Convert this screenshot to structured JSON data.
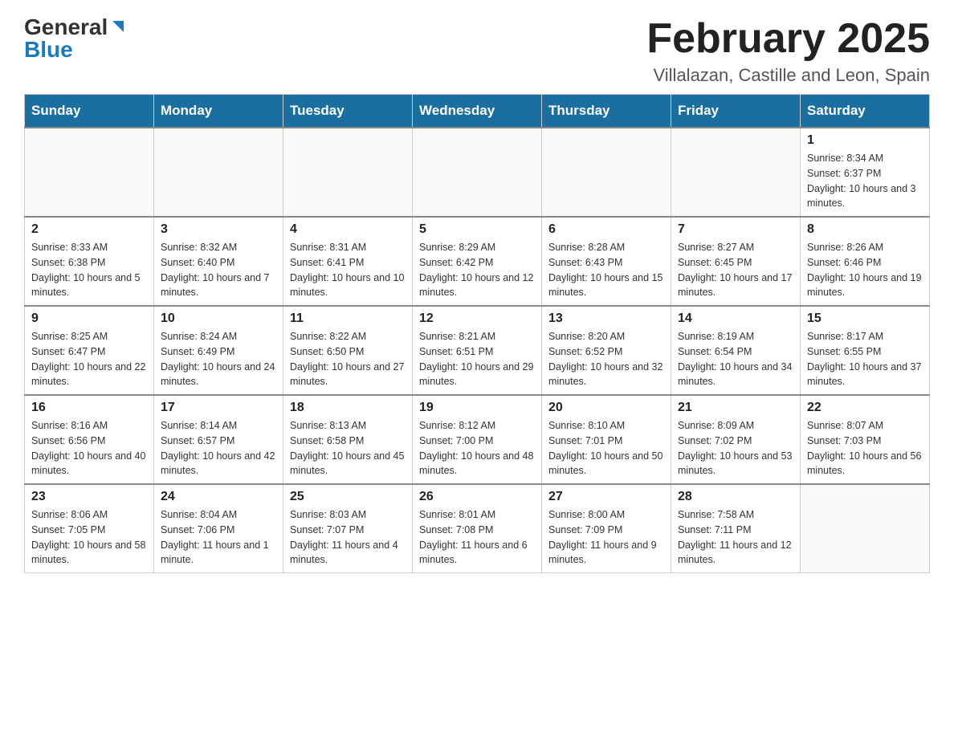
{
  "logo": {
    "general": "General",
    "blue": "Blue",
    "aria": "GeneralBlue logo"
  },
  "title": {
    "month_year": "February 2025",
    "location": "Villalazan, Castille and Leon, Spain"
  },
  "weekdays": [
    "Sunday",
    "Monday",
    "Tuesday",
    "Wednesday",
    "Thursday",
    "Friday",
    "Saturday"
  ],
  "weeks": [
    [
      {
        "day": "",
        "info": ""
      },
      {
        "day": "",
        "info": ""
      },
      {
        "day": "",
        "info": ""
      },
      {
        "day": "",
        "info": ""
      },
      {
        "day": "",
        "info": ""
      },
      {
        "day": "",
        "info": ""
      },
      {
        "day": "1",
        "info": "Sunrise: 8:34 AM\nSunset: 6:37 PM\nDaylight: 10 hours and 3 minutes."
      }
    ],
    [
      {
        "day": "2",
        "info": "Sunrise: 8:33 AM\nSunset: 6:38 PM\nDaylight: 10 hours and 5 minutes."
      },
      {
        "day": "3",
        "info": "Sunrise: 8:32 AM\nSunset: 6:40 PM\nDaylight: 10 hours and 7 minutes."
      },
      {
        "day": "4",
        "info": "Sunrise: 8:31 AM\nSunset: 6:41 PM\nDaylight: 10 hours and 10 minutes."
      },
      {
        "day": "5",
        "info": "Sunrise: 8:29 AM\nSunset: 6:42 PM\nDaylight: 10 hours and 12 minutes."
      },
      {
        "day": "6",
        "info": "Sunrise: 8:28 AM\nSunset: 6:43 PM\nDaylight: 10 hours and 15 minutes."
      },
      {
        "day": "7",
        "info": "Sunrise: 8:27 AM\nSunset: 6:45 PM\nDaylight: 10 hours and 17 minutes."
      },
      {
        "day": "8",
        "info": "Sunrise: 8:26 AM\nSunset: 6:46 PM\nDaylight: 10 hours and 19 minutes."
      }
    ],
    [
      {
        "day": "9",
        "info": "Sunrise: 8:25 AM\nSunset: 6:47 PM\nDaylight: 10 hours and 22 minutes."
      },
      {
        "day": "10",
        "info": "Sunrise: 8:24 AM\nSunset: 6:49 PM\nDaylight: 10 hours and 24 minutes."
      },
      {
        "day": "11",
        "info": "Sunrise: 8:22 AM\nSunset: 6:50 PM\nDaylight: 10 hours and 27 minutes."
      },
      {
        "day": "12",
        "info": "Sunrise: 8:21 AM\nSunset: 6:51 PM\nDaylight: 10 hours and 29 minutes."
      },
      {
        "day": "13",
        "info": "Sunrise: 8:20 AM\nSunset: 6:52 PM\nDaylight: 10 hours and 32 minutes."
      },
      {
        "day": "14",
        "info": "Sunrise: 8:19 AM\nSunset: 6:54 PM\nDaylight: 10 hours and 34 minutes."
      },
      {
        "day": "15",
        "info": "Sunrise: 8:17 AM\nSunset: 6:55 PM\nDaylight: 10 hours and 37 minutes."
      }
    ],
    [
      {
        "day": "16",
        "info": "Sunrise: 8:16 AM\nSunset: 6:56 PM\nDaylight: 10 hours and 40 minutes."
      },
      {
        "day": "17",
        "info": "Sunrise: 8:14 AM\nSunset: 6:57 PM\nDaylight: 10 hours and 42 minutes."
      },
      {
        "day": "18",
        "info": "Sunrise: 8:13 AM\nSunset: 6:58 PM\nDaylight: 10 hours and 45 minutes."
      },
      {
        "day": "19",
        "info": "Sunrise: 8:12 AM\nSunset: 7:00 PM\nDaylight: 10 hours and 48 minutes."
      },
      {
        "day": "20",
        "info": "Sunrise: 8:10 AM\nSunset: 7:01 PM\nDaylight: 10 hours and 50 minutes."
      },
      {
        "day": "21",
        "info": "Sunrise: 8:09 AM\nSunset: 7:02 PM\nDaylight: 10 hours and 53 minutes."
      },
      {
        "day": "22",
        "info": "Sunrise: 8:07 AM\nSunset: 7:03 PM\nDaylight: 10 hours and 56 minutes."
      }
    ],
    [
      {
        "day": "23",
        "info": "Sunrise: 8:06 AM\nSunset: 7:05 PM\nDaylight: 10 hours and 58 minutes."
      },
      {
        "day": "24",
        "info": "Sunrise: 8:04 AM\nSunset: 7:06 PM\nDaylight: 11 hours and 1 minute."
      },
      {
        "day": "25",
        "info": "Sunrise: 8:03 AM\nSunset: 7:07 PM\nDaylight: 11 hours and 4 minutes."
      },
      {
        "day": "26",
        "info": "Sunrise: 8:01 AM\nSunset: 7:08 PM\nDaylight: 11 hours and 6 minutes."
      },
      {
        "day": "27",
        "info": "Sunrise: 8:00 AM\nSunset: 7:09 PM\nDaylight: 11 hours and 9 minutes."
      },
      {
        "day": "28",
        "info": "Sunrise: 7:58 AM\nSunset: 7:11 PM\nDaylight: 11 hours and 12 minutes."
      },
      {
        "day": "",
        "info": ""
      }
    ]
  ]
}
